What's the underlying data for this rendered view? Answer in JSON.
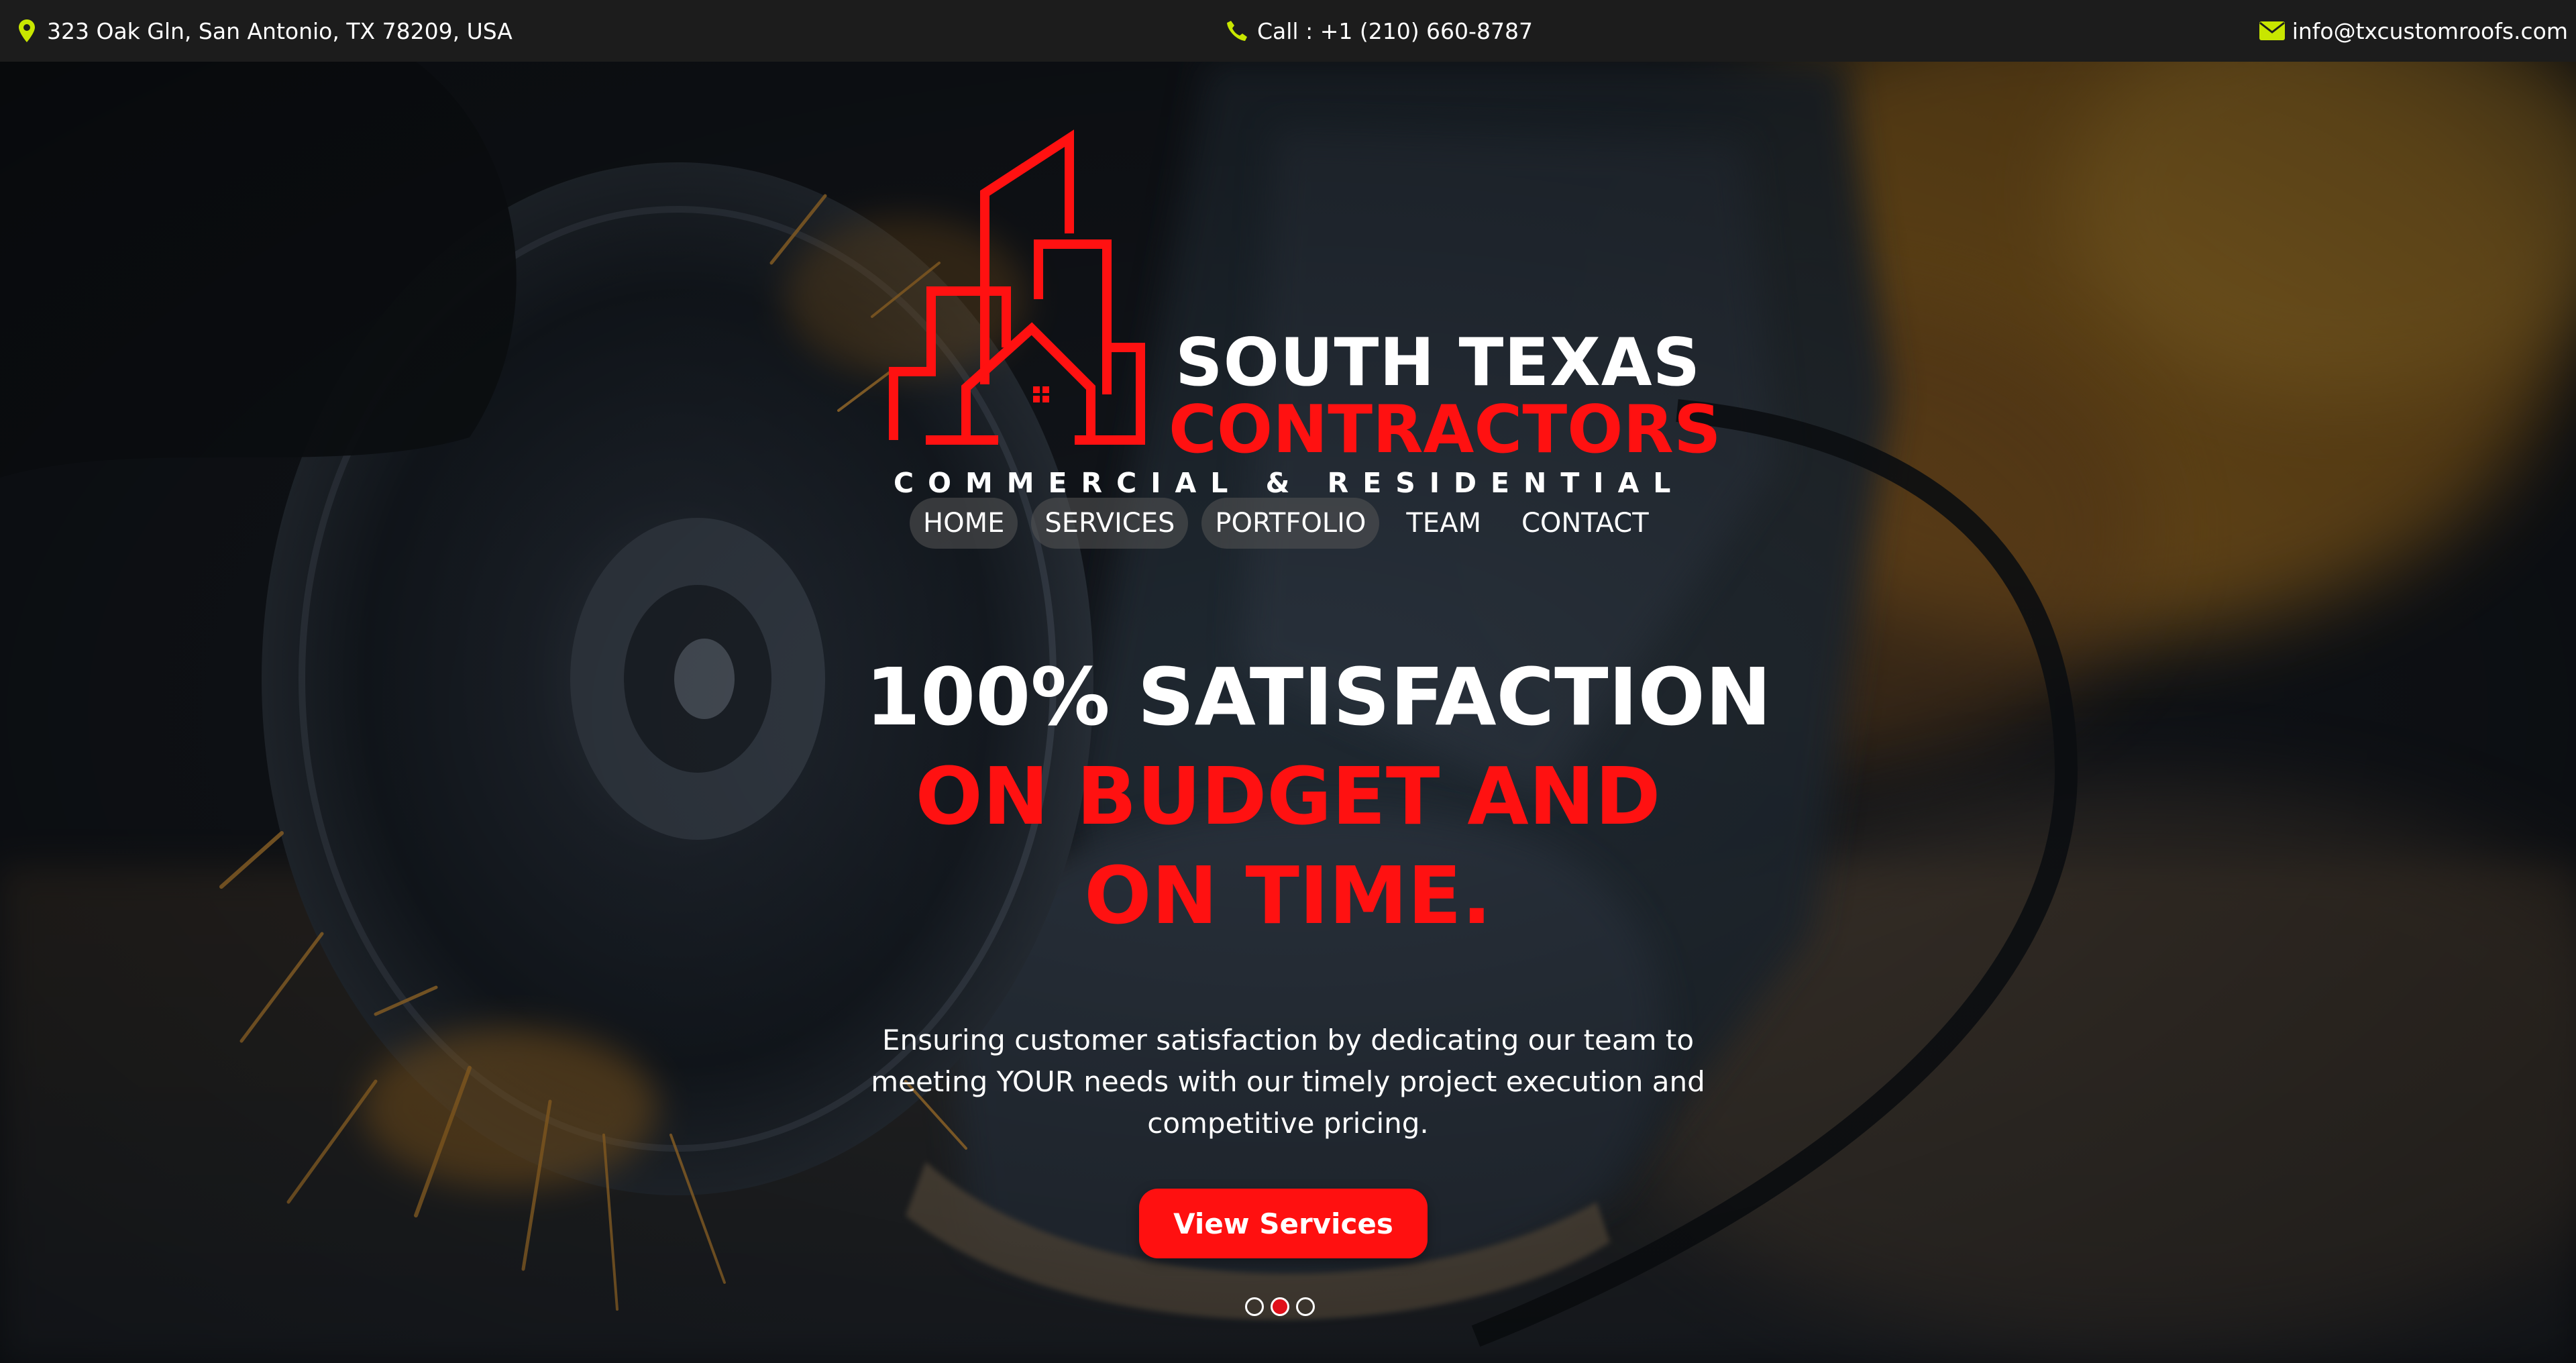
{
  "topbar": {
    "address": "323 Oak Gln, San Antonio, TX 78209, USA",
    "phone": "Call : +1 (210) 660-8787",
    "email": "info@txcustomroofs.com",
    "icon_color": "#c8e600"
  },
  "logo": {
    "title_line1": "SOUTH TEXAS",
    "title_line2": "CONTRACTORS",
    "tagline": "COMMERCIAL & RESIDENTIAL",
    "accent_color": "#ff1111"
  },
  "nav": {
    "items": [
      {
        "label": "HOME"
      },
      {
        "label": "SERVICES"
      },
      {
        "label": "PORTFOLIO"
      },
      {
        "label": "TEAM"
      },
      {
        "label": "CONTACT"
      }
    ]
  },
  "hero": {
    "headline_line1": "100% SATISFACTION",
    "headline_line2": "ON BUDGET AND ON TIME.",
    "subtext": "Ensuring customer satisfaction by dedicating our team to meeting YOUR needs with our timely project execution and competitive pricing.",
    "cta_label": "View Services",
    "slide_count": 3,
    "active_slide": 2,
    "accent_color": "#ff1010"
  }
}
